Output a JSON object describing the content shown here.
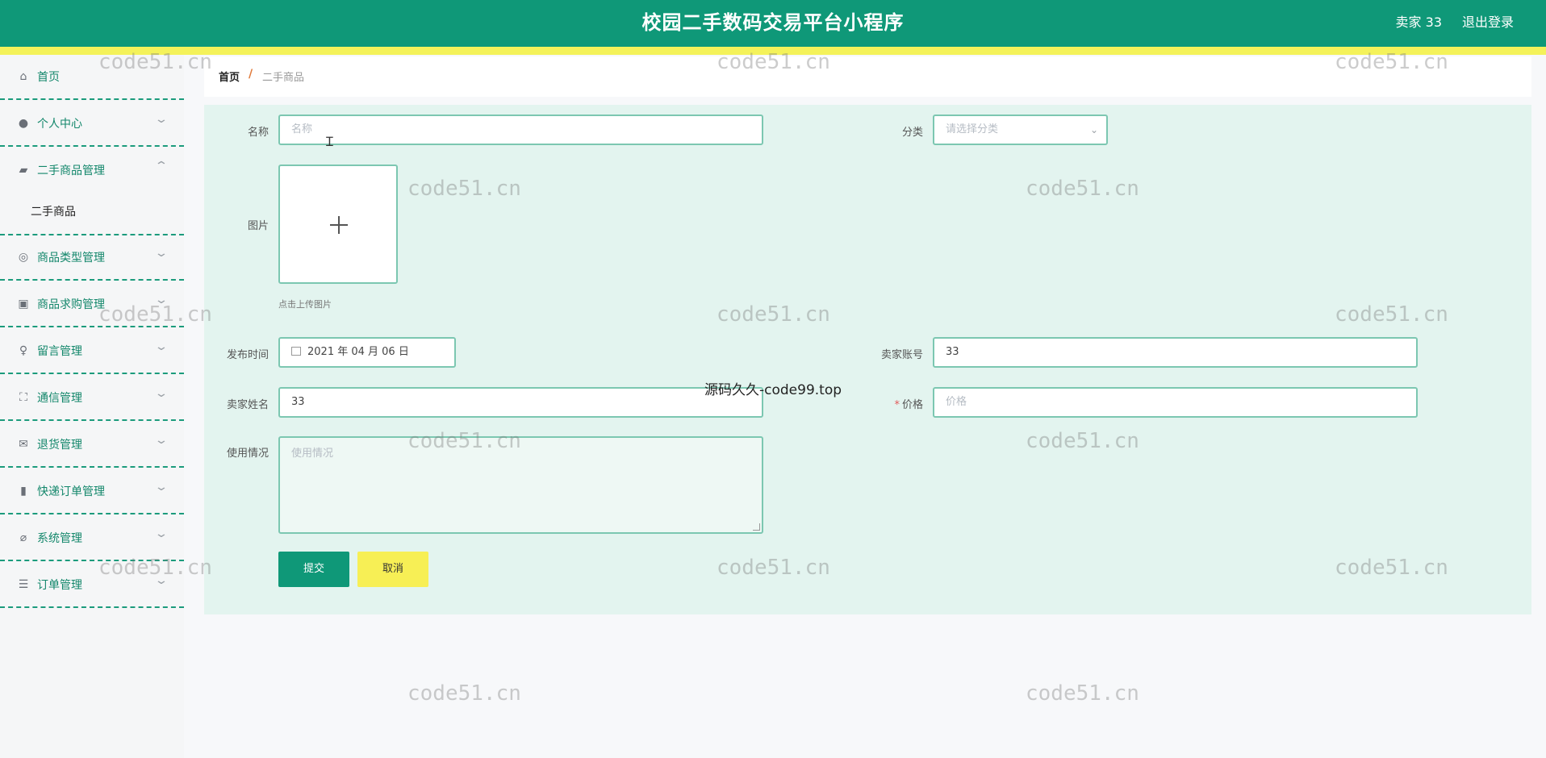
{
  "header": {
    "title": "校园二手数码交易平台小程序",
    "user": "卖家 33",
    "logout": "退出登录"
  },
  "sidebar": {
    "items": [
      {
        "label": "首页",
        "icon": "home-icon",
        "glyph": "⌂",
        "chevron": ""
      },
      {
        "label": "个人中心",
        "icon": "user-icon",
        "glyph": "●",
        "chevron": "⌄"
      },
      {
        "label": "二手商品管理",
        "icon": "shop-icon",
        "glyph": "▰",
        "chevron": "⌃"
      },
      {
        "label": "商品类型管理",
        "icon": "compass-icon",
        "glyph": "◎",
        "chevron": "⌄"
      },
      {
        "label": "商品求购管理",
        "icon": "chart-icon",
        "glyph": "▣",
        "chevron": "⌄"
      },
      {
        "label": "留言管理",
        "icon": "mic-icon",
        "glyph": "♀",
        "chevron": "⌄"
      },
      {
        "label": "通信管理",
        "icon": "fullscreen-icon",
        "glyph": "⛶",
        "chevron": "⌄"
      },
      {
        "label": "退货管理",
        "icon": "mail-icon",
        "glyph": "✉",
        "chevron": "⌄"
      },
      {
        "label": "快递订单管理",
        "icon": "bar-chart-icon",
        "glyph": "▮",
        "chevron": "⌄"
      },
      {
        "label": "系统管理",
        "icon": "bell-off-icon",
        "glyph": "⌀",
        "chevron": "⌄"
      },
      {
        "label": "订单管理",
        "icon": "menu-icon",
        "glyph": "☰",
        "chevron": "⌄"
      }
    ],
    "submenu_active": "二手商品"
  },
  "breadcrumb": {
    "home": "首页",
    "separator": "/",
    "current": "二手商品"
  },
  "form": {
    "name_label": "名称",
    "name_placeholder": "名称",
    "category_label": "分类",
    "category_placeholder": "请选择分类",
    "image_label": "图片",
    "upload_hint": "点击上传图片",
    "publish_time_label": "发布时间",
    "publish_time_value": "2021 年 04 月 06 日",
    "seller_account_label": "卖家账号",
    "seller_account_value": "33",
    "seller_name_label": "卖家姓名",
    "seller_name_value": "33",
    "price_label": "价格",
    "price_required": "*",
    "price_placeholder": "价格",
    "usage_label": "使用情况",
    "usage_placeholder": "使用情况",
    "submit_label": "提交",
    "cancel_label": "取消"
  },
  "overlay": "源码久久-code99.top",
  "watermark": "code51.cn",
  "colors": {
    "primary": "#0f9878",
    "accent_yellow": "#f7ef55",
    "panel_bg": "#e3f4ef",
    "input_border": "#7cc7b1"
  }
}
